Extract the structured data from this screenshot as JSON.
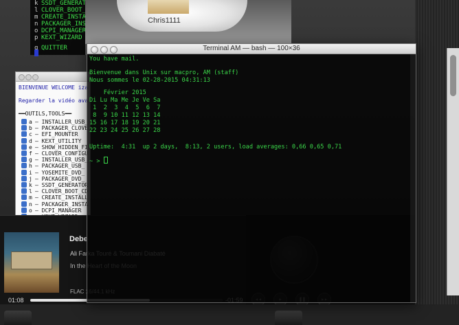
{
  "bg_menu": {
    "lines": [
      {
        "key": "k",
        "label": "SSDT_GENERATOR"
      },
      {
        "key": "l",
        "label": "CLOVER_BOOT_CD"
      },
      {
        "key": "m",
        "label": "CREATE_INSTALL_MEDIA"
      },
      {
        "key": "n",
        "label": "PACKAGER_INSTALL_MEDIA_EFI"
      },
      {
        "key": "o",
        "label": "DCPI_MANAGER"
      },
      {
        "key": "p",
        "label": "KEXT_WIZARD"
      },
      {
        "key": "q",
        "label": "QUITTER"
      }
    ]
  },
  "image_window": {
    "caption": "Chris1111"
  },
  "left_window": {
    "welcome": "BIENVENUE WELCOME iza",
    "video_hint": "Regarder la vidéo ava",
    "section": "OUTILS,TOOLS",
    "options": [
      {
        "key": "a",
        "label": "INSTALLER_USB_"
      },
      {
        "key": "b",
        "label": "PACKAGER_CLOVE"
      },
      {
        "key": "c",
        "label": "EFI_MOUNTER"
      },
      {
        "key": "d",
        "label": "KEXT_UTILITY"
      },
      {
        "key": "e",
        "label": "SHOW_HIDDEN_FI"
      },
      {
        "key": "f",
        "label": "CLOVER_CONFIGU"
      },
      {
        "key": "g",
        "label": "INSTALLER_USB_"
      },
      {
        "key": "h",
        "label": "PACKAGER_USB_"
      },
      {
        "key": "i",
        "label": "YOSEMITE_DVD_"
      },
      {
        "key": "j",
        "label": "PACKAGER_DVD_"
      },
      {
        "key": "k",
        "label": "SSDT_GENERATOR"
      },
      {
        "key": "l",
        "label": "CLOVER_BOOT_CD"
      },
      {
        "key": "m",
        "label": "CREATE_INSTALL"
      },
      {
        "key": "n",
        "label": "PACKAGER_INSTA"
      },
      {
        "key": "o",
        "label": "DCPI_MANAGER"
      },
      {
        "key": "p",
        "label": "KEXT_WIZARD"
      }
    ]
  },
  "terminal": {
    "title": "Terminal AM — bash — 100×36",
    "mail": "You have mail.",
    "welcome": "Bienvenue dans Unix sur macpro, AM (staff)",
    "date_line": "Nous sommes le 02-28-2015 04:31:13",
    "cal_title": "    Février 2015",
    "cal_rows": [
      "Di Lu Ma Me Je Ve Sa",
      " 1  2  3  4  5  6  7",
      " 8  9 10 11 12 13 14",
      "15 16 17 18 19 20 21",
      "22 23 24 25 26 27 28"
    ],
    "uptime": "Uptime:  4:31  up 2 days,  8:13, 2 users, load averages: 0,66 0,65 0,71",
    "prompt": "~ >"
  },
  "player": {
    "title": "Debe",
    "artist": "Ali Farka Touré & Toumani Diabaté",
    "album": "In the Heart of the Moon",
    "format": "FLAC 16/44.1 kHz",
    "sample": "",
    "elapsed": "01:08",
    "remaining": "-01:59",
    "progress": 0.62
  },
  "icons": {
    "close": "close-icon",
    "minimize": "minimize-icon",
    "zoom": "zoom-icon",
    "option_button": "square-button-icon",
    "knob": "volume-knob-icon"
  }
}
